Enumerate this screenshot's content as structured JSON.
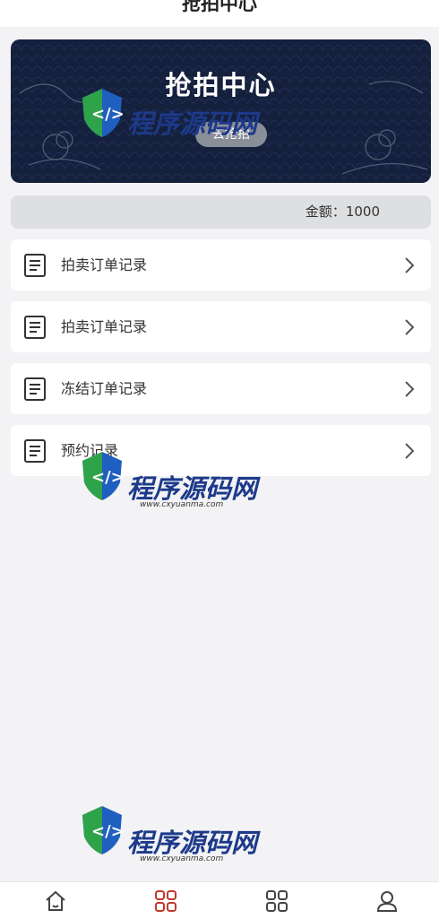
{
  "header": {
    "title": "抢拍中心"
  },
  "banner": {
    "title": "抢拍中心",
    "button_label": "去抢拍"
  },
  "account": {
    "amount_label": "金额：",
    "amount_value": "1000"
  },
  "menu": {
    "items": [
      {
        "label": "拍卖订单记录",
        "icon": "document-list-icon"
      },
      {
        "label": "拍卖订单记录",
        "icon": "document-list-icon"
      },
      {
        "label": "冻结订单记录",
        "icon": "document-list-icon"
      },
      {
        "label": "预约记录",
        "icon": "document-list-icon"
      }
    ]
  },
  "watermark": {
    "brand": "程序源码网",
    "url": "www.cxyuanma.com"
  },
  "tabbar": {
    "items": [
      {
        "icon": "home-icon",
        "active": false
      },
      {
        "icon": "grid-icon",
        "active": true
      },
      {
        "icon": "grid-icon",
        "active": false
      },
      {
        "icon": "user-icon",
        "active": false
      }
    ]
  },
  "colors": {
    "banner_bg": "#15203d",
    "active_tab": "#c0392b",
    "page_bg": "#f3f3f5"
  }
}
